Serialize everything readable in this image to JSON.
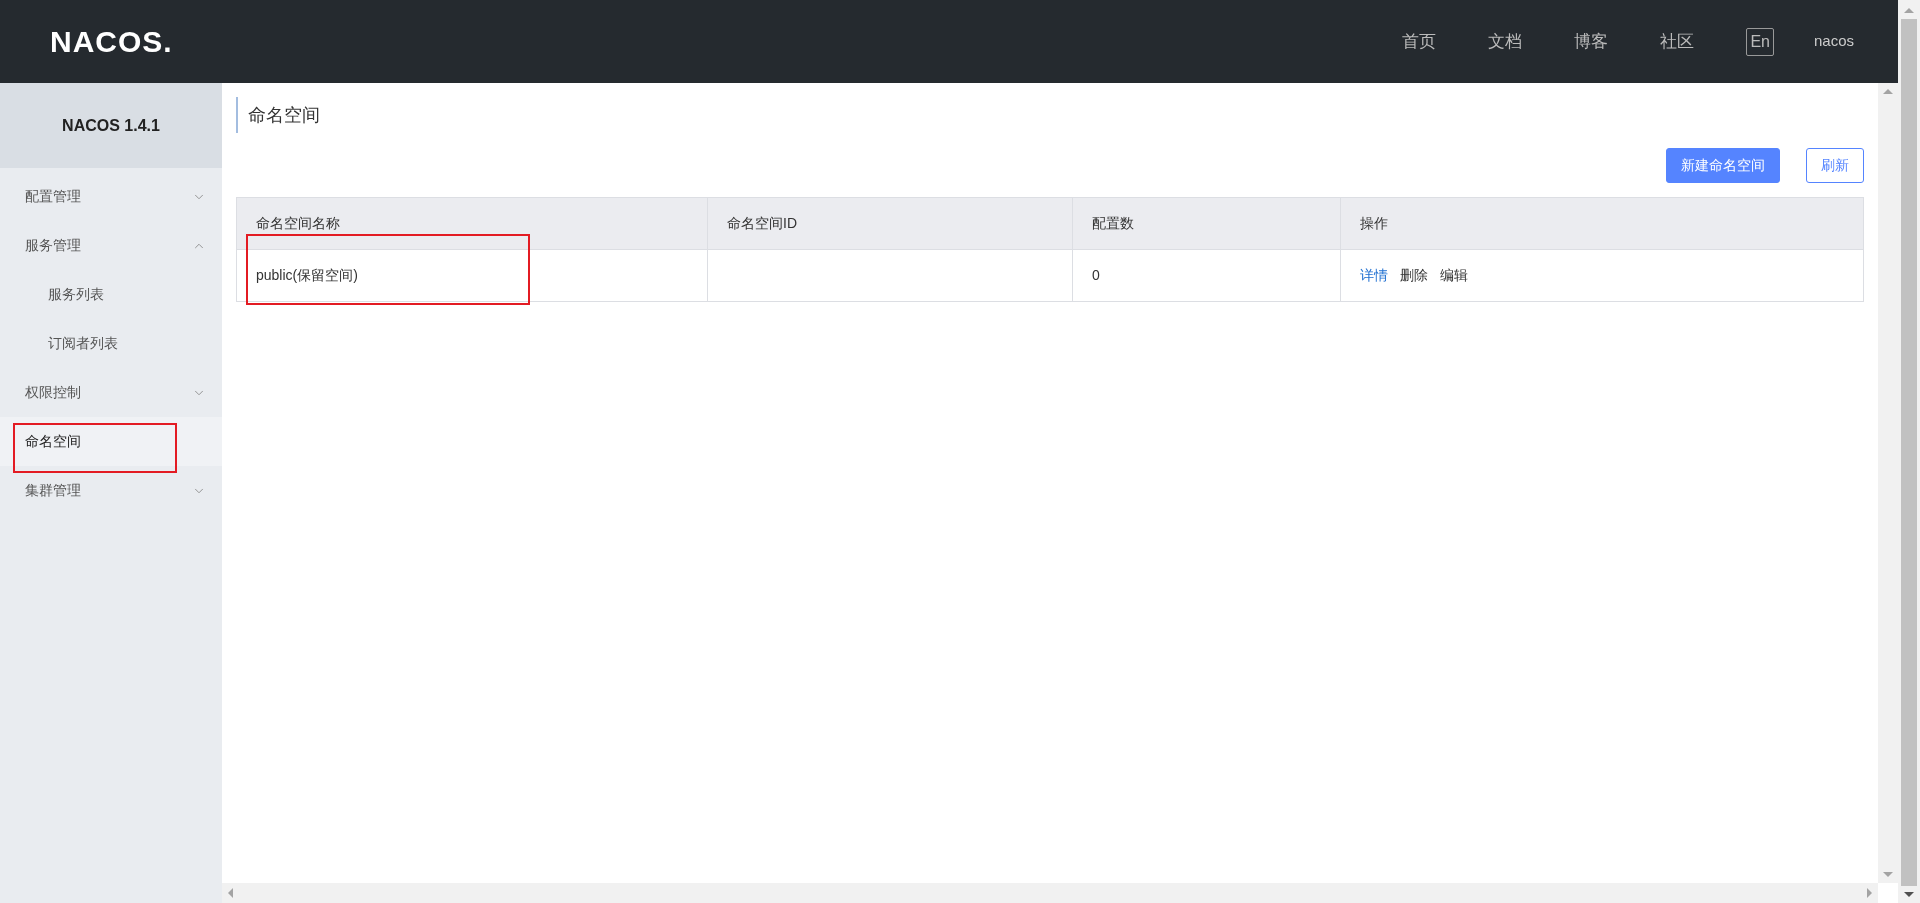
{
  "header": {
    "logo": "NACOS.",
    "nav": [
      "首页",
      "文档",
      "博客",
      "社区"
    ],
    "language": "En",
    "user": "nacos"
  },
  "sidebar": {
    "version": "NACOS 1.4.1",
    "items": [
      {
        "label": "配置管理",
        "expanded": false,
        "selected": false
      },
      {
        "label": "服务管理",
        "expanded": true,
        "selected": false,
        "children": [
          {
            "label": "服务列表",
            "selected": false
          },
          {
            "label": "订阅者列表",
            "selected": false
          }
        ]
      },
      {
        "label": "权限控制",
        "expanded": false,
        "selected": false
      },
      {
        "label": "命名空间",
        "selected": true
      },
      {
        "label": "集群管理",
        "expanded": false,
        "selected": false
      }
    ]
  },
  "page": {
    "title": "命名空间",
    "buttons": [
      {
        "label": "新建命名空间",
        "kind": "primary"
      },
      {
        "label": "刷新",
        "kind": "outline"
      }
    ]
  },
  "table": {
    "columns": [
      "命名空间名称",
      "命名空间ID",
      "配置数",
      "操作"
    ],
    "rows": [
      {
        "name": "public(保留空间)",
        "id": "",
        "count": "0",
        "actions": [
          {
            "label": "详情",
            "kind": "link"
          },
          {
            "label": "删除",
            "kind": "plain"
          },
          {
            "label": "编辑",
            "kind": "plain"
          }
        ]
      }
    ]
  }
}
